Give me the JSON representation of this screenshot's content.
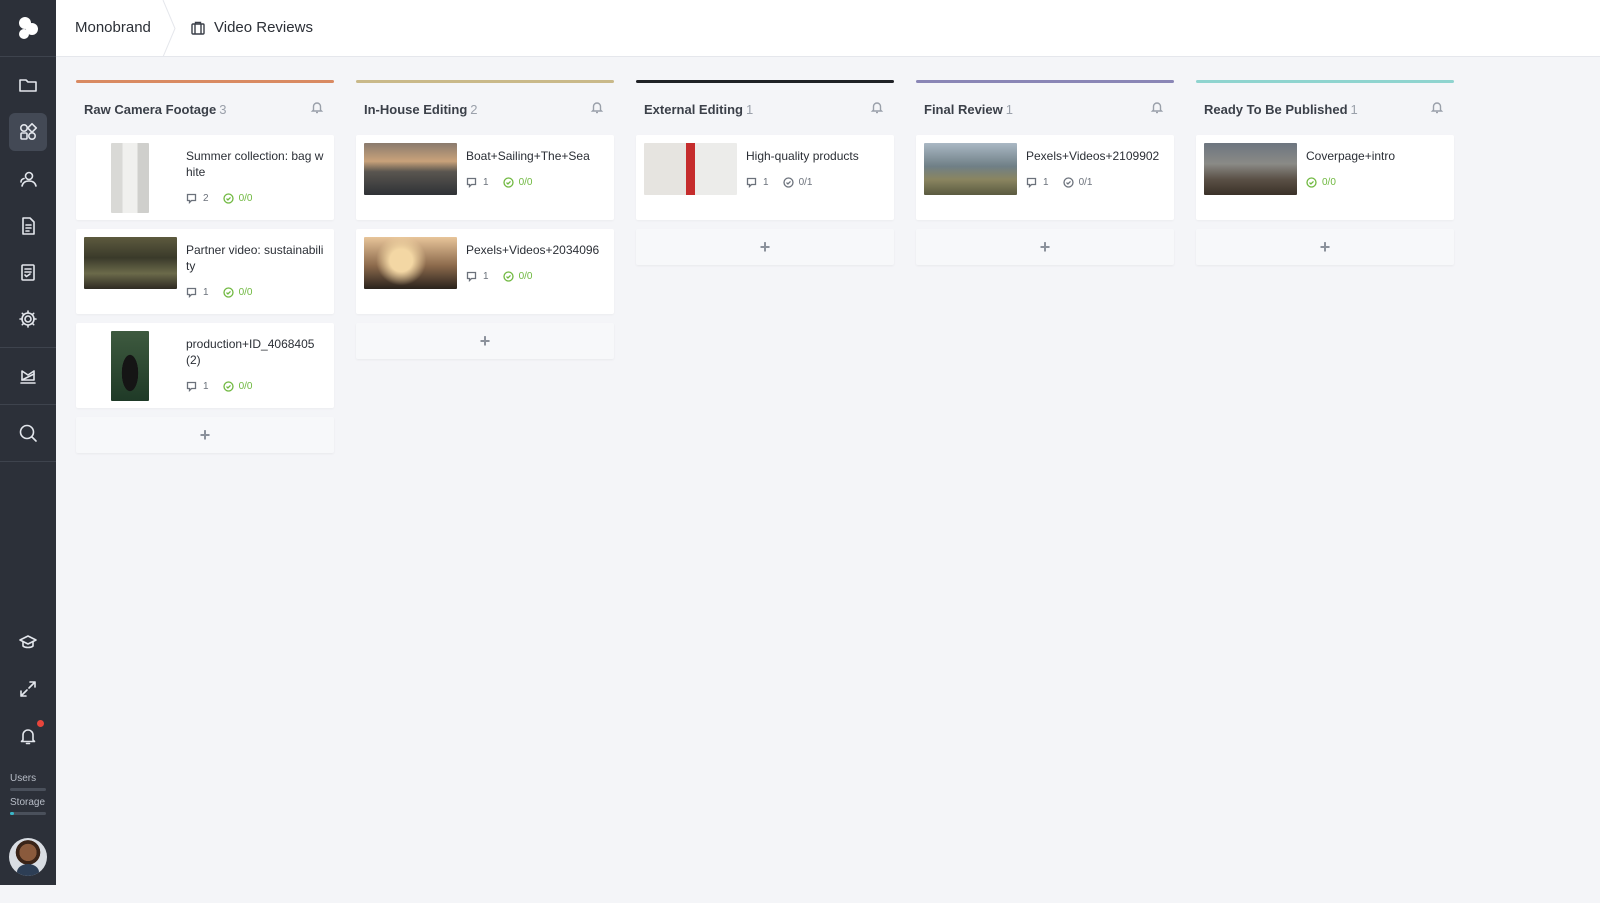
{
  "breadcrumb": {
    "root": "Monobrand",
    "current": "Video Reviews"
  },
  "sidebar": {
    "items": [
      "logo-icon",
      "folder-icon",
      "apps-icon",
      "users-icon",
      "document-icon",
      "checklist-icon",
      "gear-icon",
      "brand-icon",
      "search-icon",
      "graduation-icon",
      "expand-icon",
      "bell-icon"
    ],
    "active": "apps-icon",
    "meters": [
      {
        "label": "Users",
        "fill": 0
      },
      {
        "label": "Storage",
        "fill": 0.1
      }
    ]
  },
  "columns": [
    {
      "title": "Raw Camera Footage",
      "count": "3",
      "color": "#d98a62",
      "cards": [
        {
          "title": "Summer collection: bag white",
          "comments": "2",
          "approvals": "0/0",
          "approvals_green": true,
          "thumb": "white-bag"
        },
        {
          "title": "Partner video: sustainability",
          "comments": "1",
          "approvals": "0/0",
          "approvals_green": true,
          "thumb": "forest-cabin"
        },
        {
          "title": "production+ID_4068405 (2)",
          "comments": "1",
          "approvals": "0/0",
          "approvals_green": true,
          "thumb": "black-bag"
        }
      ]
    },
    {
      "title": "In-House Editing",
      "count": "2",
      "color": "#c9b98a",
      "cards": [
        {
          "title": "Boat+Sailing+The+Sea",
          "comments": "1",
          "approvals": "0/0",
          "approvals_green": true,
          "thumb": "sunset-sea"
        },
        {
          "title": "Pexels+Videos+2034096",
          "comments": "1",
          "approvals": "0/0",
          "approvals_green": true,
          "thumb": "couple-sunset"
        }
      ]
    },
    {
      "title": "External Editing",
      "count": "1",
      "color": "#1f2226",
      "cards": [
        {
          "title": "High-quality products",
          "comments": "1",
          "approvals": "0/1",
          "approvals_green": false,
          "thumb": "products"
        }
      ]
    },
    {
      "title": "Final Review",
      "count": "1",
      "color": "#8a86b6",
      "cards": [
        {
          "title": "Pexels+Videos+2109902",
          "comments": "1",
          "approvals": "0/1",
          "approvals_green": false,
          "thumb": "mountains"
        }
      ]
    },
    {
      "title": "Ready To Be Published",
      "count": "1",
      "color": "#8fd4cf",
      "cards": [
        {
          "title": "Coverpage+intro",
          "comments": "",
          "approvals": "0/0",
          "approvals_green": true,
          "thumb": "hill-town"
        }
      ]
    }
  ],
  "add_label": "+"
}
